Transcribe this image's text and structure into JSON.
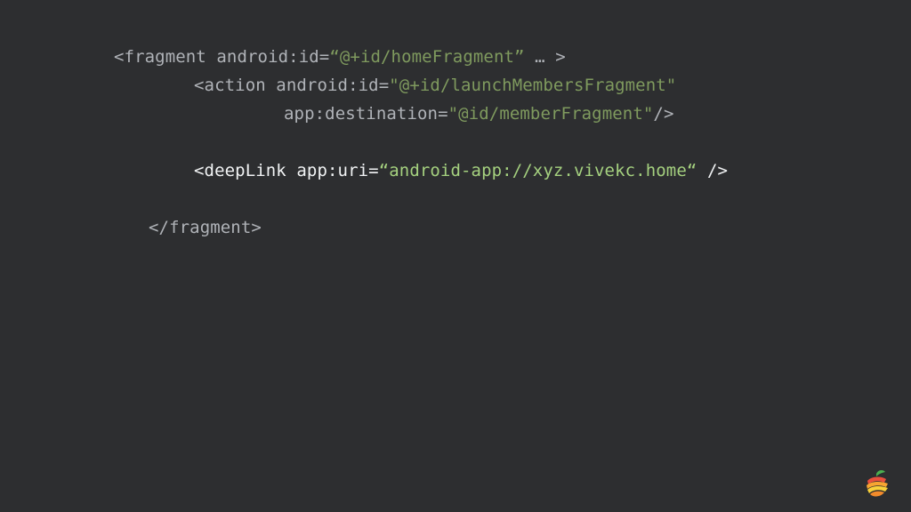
{
  "code": {
    "line1": {
      "tag_open": "<fragment android:id=",
      "value": "“@+id/homeFragment”",
      "tail": " … >"
    },
    "line2": {
      "tag_open": "<action android:id=",
      "value": "\"@+id/launchMembersFragment\""
    },
    "line3": {
      "attr": "app:destination=",
      "value": "\"@id/memberFragment\"",
      "tail": "/>"
    },
    "line4": {
      "tag_open": "<deepLink app:uri=",
      "value": "“android-app://xyz.vivekc.home“",
      "tail": " />"
    },
    "line5": {
      "tag_close": "</fragment>"
    }
  },
  "logo": {
    "icon": "fruit-logo-icon"
  },
  "colors": {
    "background": "#2d2e30",
    "text_dim": "#b0b3b8",
    "text_bright": "#f1f3f4",
    "string_dim": "#7f9a5e",
    "string_bright": "#a5d17f"
  }
}
